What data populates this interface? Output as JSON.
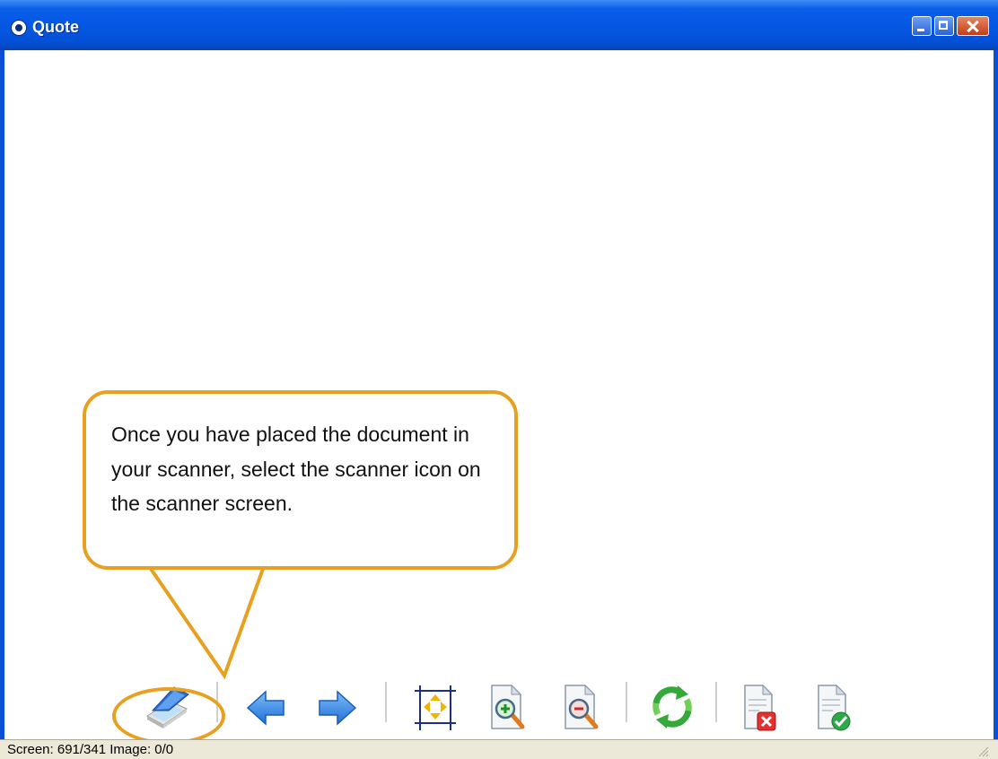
{
  "window": {
    "title": "Quote"
  },
  "callout": {
    "text": "Once you have placed the document in your scanner, select the scanner icon on the scanner screen."
  },
  "toolbar": {
    "items": [
      {
        "name": "scan-button",
        "icon": "scanner-icon"
      },
      {
        "name": "previous-page-button",
        "icon": "arrow-left-icon"
      },
      {
        "name": "next-page-button",
        "icon": "arrow-right-icon"
      },
      {
        "name": "fit-to-screen-button",
        "icon": "fit-page-icon"
      },
      {
        "name": "zoom-in-button",
        "icon": "zoom-in-icon"
      },
      {
        "name": "zoom-out-button",
        "icon": "zoom-out-icon"
      },
      {
        "name": "rotate-button",
        "icon": "rotate-arrows-icon"
      },
      {
        "name": "cancel-button",
        "icon": "document-delete-icon"
      },
      {
        "name": "accept-button",
        "icon": "document-accept-icon"
      }
    ]
  },
  "statusbar": {
    "text": "Screen: 691/341 Image: 0/0"
  },
  "colors": {
    "titlebar": "#0457e3",
    "callout_border": "#e8a020",
    "arrow_blue": "#2a88e8",
    "rotate_green": "#3bb03b",
    "delete_red": "#e23a2a"
  }
}
